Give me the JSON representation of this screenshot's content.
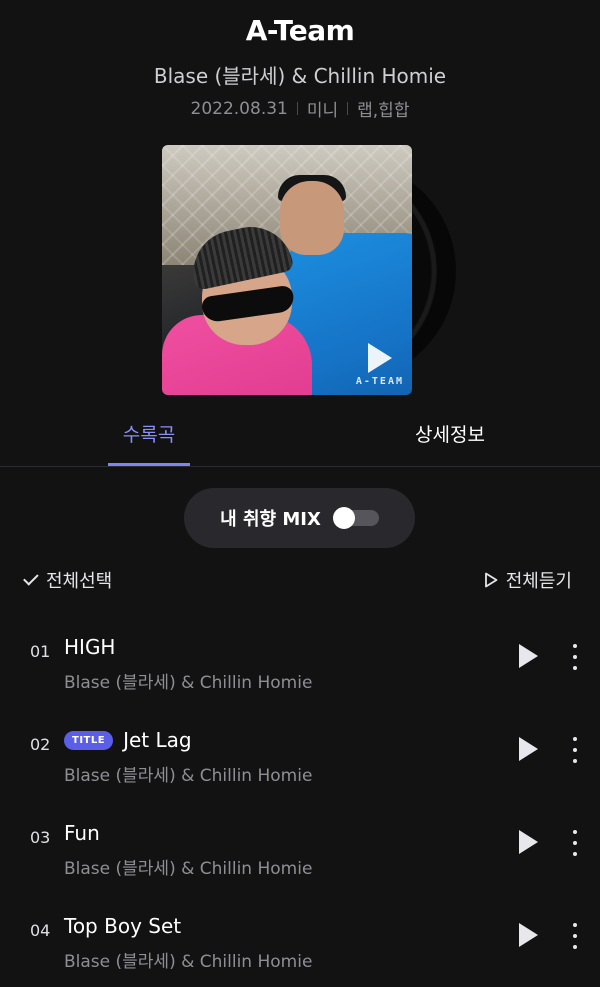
{
  "album": {
    "title": "A-Team",
    "artist": "Blase (블라세) & Chillin Homie",
    "date": "2022.08.31",
    "type": "미니",
    "genre": "랩,힙합",
    "cover_text": "A-TEAM"
  },
  "tabs": [
    {
      "label": "수록곡",
      "active": true
    },
    {
      "label": "상세정보",
      "active": false
    }
  ],
  "mix": {
    "label": "내 취향 MIX",
    "enabled": false
  },
  "actions": {
    "select_all": "전체선택",
    "play_all": "전체듣기"
  },
  "tracks": [
    {
      "number": "01",
      "title": "HIGH",
      "artist": "Blase (블라세) & Chillin Homie",
      "badge": ""
    },
    {
      "number": "02",
      "title": "Jet Lag",
      "artist": "Blase (블라세) & Chillin Homie",
      "badge": "TITLE"
    },
    {
      "number": "03",
      "title": "Fun",
      "artist": "Blase (블라세) & Chillin Homie",
      "badge": ""
    },
    {
      "number": "04",
      "title": "Top Boy Set",
      "artist": "Blase (블라세) & Chillin Homie",
      "badge": ""
    }
  ],
  "colors": {
    "accent": "#7f86f0",
    "badge": "#5b5fe8",
    "background": "#121213"
  }
}
